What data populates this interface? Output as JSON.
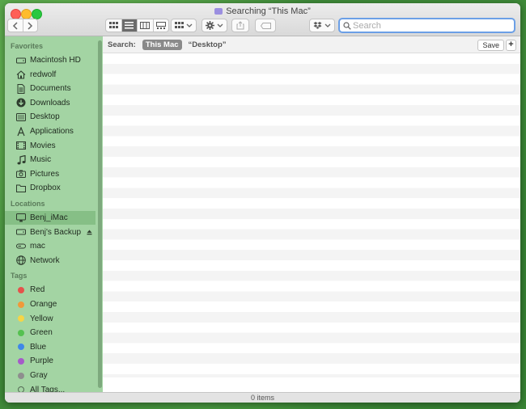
{
  "window": {
    "title": "Searching “This Mac”"
  },
  "toolbar": {
    "back_icon": "chevron-left-icon",
    "forward_icon": "chevron-right-icon",
    "view_modes": [
      "icon-view",
      "list-view",
      "column-view",
      "gallery-view"
    ],
    "active_view": "list-view",
    "search": {
      "value": "",
      "placeholder": "Search"
    }
  },
  "sidebar": {
    "favorites_heading": "Favorites",
    "favorites": [
      {
        "label": "Macintosh HD",
        "icon": "drive-icon"
      },
      {
        "label": "redwolf",
        "icon": "home-icon"
      },
      {
        "label": "Documents",
        "icon": "document-icon"
      },
      {
        "label": "Downloads",
        "icon": "download-icon"
      },
      {
        "label": "Desktop",
        "icon": "desktop-icon"
      },
      {
        "label": "Applications",
        "icon": "applications-icon"
      },
      {
        "label": "Movies",
        "icon": "film-icon"
      },
      {
        "label": "Music",
        "icon": "music-icon"
      },
      {
        "label": "Pictures",
        "icon": "camera-icon"
      },
      {
        "label": "Dropbox",
        "icon": "folder-icon"
      }
    ],
    "locations_heading": "Locations",
    "locations": [
      {
        "label": "Benj_iMac",
        "icon": "imac-icon",
        "selected": true
      },
      {
        "label": "Benj's Backup",
        "icon": "drive-icon",
        "eject": true
      },
      {
        "label": "mac",
        "icon": "network-drive-icon"
      },
      {
        "label": "Network",
        "icon": "globe-icon"
      }
    ],
    "tags_heading": "Tags",
    "tags": [
      {
        "label": "Red",
        "color": "#e5534b"
      },
      {
        "label": "Orange",
        "color": "#f0993a"
      },
      {
        "label": "Yellow",
        "color": "#f5d547"
      },
      {
        "label": "Green",
        "color": "#55c150"
      },
      {
        "label": "Blue",
        "color": "#3f88e8"
      },
      {
        "label": "Purple",
        "color": "#a55bc9"
      },
      {
        "label": "Gray",
        "color": "#8e8e8e"
      },
      {
        "label": "All Tags...",
        "color": ""
      }
    ]
  },
  "scope_bar": {
    "label": "Search:",
    "options": [
      "This Mac",
      "“Desktop”"
    ],
    "selected": "This Mac",
    "save_label": "Save",
    "add_label": "+"
  },
  "status": {
    "text": "0 items"
  }
}
